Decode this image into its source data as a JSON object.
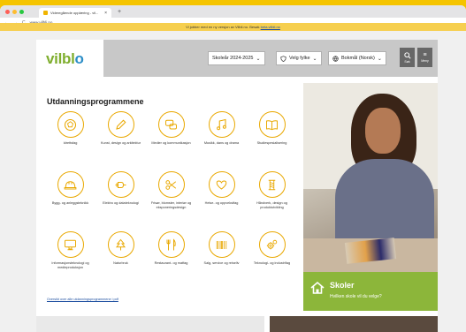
{
  "browser": {
    "tab_title": "Videregående opplæring - vil...",
    "tab_close": "×",
    "new_tab": "+",
    "nav": {
      "back": "←",
      "forward": "→",
      "reload": "C"
    },
    "url": "www.vilbli.no"
  },
  "notice": {
    "text": "Vi jobber med en ny versjon av Vilbli.no. Besøk ",
    "link": "beta.vilbli.no"
  },
  "header": {
    "logo_main": "vilbl",
    "logo_o": "o",
    "school_year": "Skoleår 2024-2025",
    "county": "Velg fylke",
    "language": "Bokmål (Norsk)",
    "search_label": "Søk",
    "menu_label": "Meny",
    "chevron": "⌄"
  },
  "main": {
    "heading": "Utdanningsprogrammene",
    "programs": [
      {
        "label": "Idrettsfag",
        "icon": "ball-icon"
      },
      {
        "label": "Kunst, design og arkitektur",
        "icon": "pencil-icon"
      },
      {
        "label": "Medier og kommunikasjon",
        "icon": "speech-bubble-icon"
      },
      {
        "label": "Musikk, dans og drama",
        "icon": "music-note-icon"
      },
      {
        "label": "Studiespesialisering",
        "icon": "book-icon"
      },
      {
        "label": "Bygg- og anleggsteknikk",
        "icon": "helmet-icon"
      },
      {
        "label": "Elektro og datateknologi",
        "icon": "plug-icon"
      },
      {
        "label": "Frisør, blomster, interiør og eksponeringsdesign",
        "icon": "scissors-icon"
      },
      {
        "label": "Helse- og oppvekstfag",
        "icon": "heart-hands-icon"
      },
      {
        "label": "Håndverk, design og produktutvikling",
        "icon": "thread-spool-icon"
      },
      {
        "label": "Informasjonsteknologi og medieproduksjon",
        "icon": "monitor-icon"
      },
      {
        "label": "Naturbruk",
        "icon": "tree-icon"
      },
      {
        "label": "Restaurant- og matfag",
        "icon": "cutlery-icon"
      },
      {
        "label": "Salg, service og reiseliv",
        "icon": "barcode-icon"
      },
      {
        "label": "Teknologi- og industrifag",
        "icon": "gears-icon"
      }
    ],
    "footer_link": "Oversikt over alle utdanningsprogrammene i pdf"
  },
  "skoler": {
    "title": "Skoler",
    "subtitle": "Hvilken skole vil du velge?"
  },
  "colors": {
    "accent_yellow": "#e9a800",
    "brand_green": "#8cb63a",
    "brand_blue": "#2c8ec7",
    "notice_bg": "#f6cf4f"
  }
}
